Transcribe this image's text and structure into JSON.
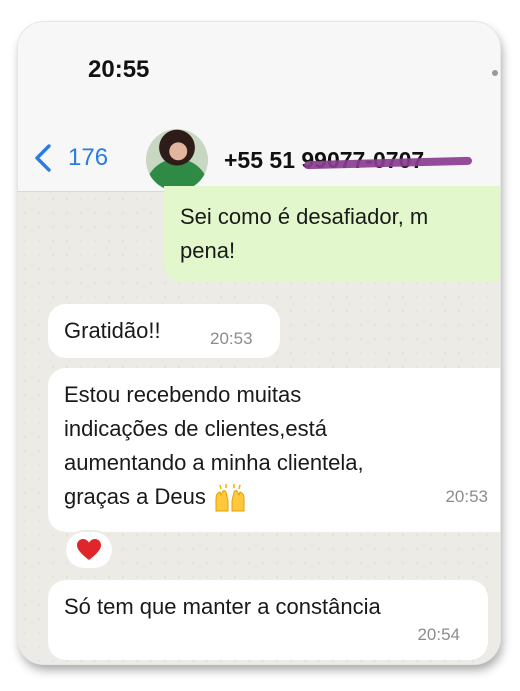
{
  "status_bar": {
    "time": "20:55"
  },
  "header": {
    "back_count": "176",
    "contact_number": "+55 51 99077-0707"
  },
  "messages": [
    {
      "direction": "outgoing",
      "text": "Sei como é desafiador, m\npena!"
    },
    {
      "direction": "incoming",
      "text": "Gratidão!!",
      "time": "20:53"
    },
    {
      "direction": "incoming",
      "text": "Estou recebendo muitas\nindicações de clientes,está\naumentando a minha clientela,\ngraças a Deus",
      "emoji": "raising-hands-icon",
      "time": "20:53",
      "reaction": "heart-icon"
    },
    {
      "direction": "incoming",
      "text": "Só tem que manter a constância",
      "time": "20:54"
    }
  ],
  "colors": {
    "accent": "#2a7be4",
    "outgoing_bubble": "#e2f7cb",
    "incoming_bubble": "#ffffff",
    "chat_background": "#ecebe6",
    "redaction": "#8a3e8f",
    "reaction_heart": "#e0262b"
  }
}
